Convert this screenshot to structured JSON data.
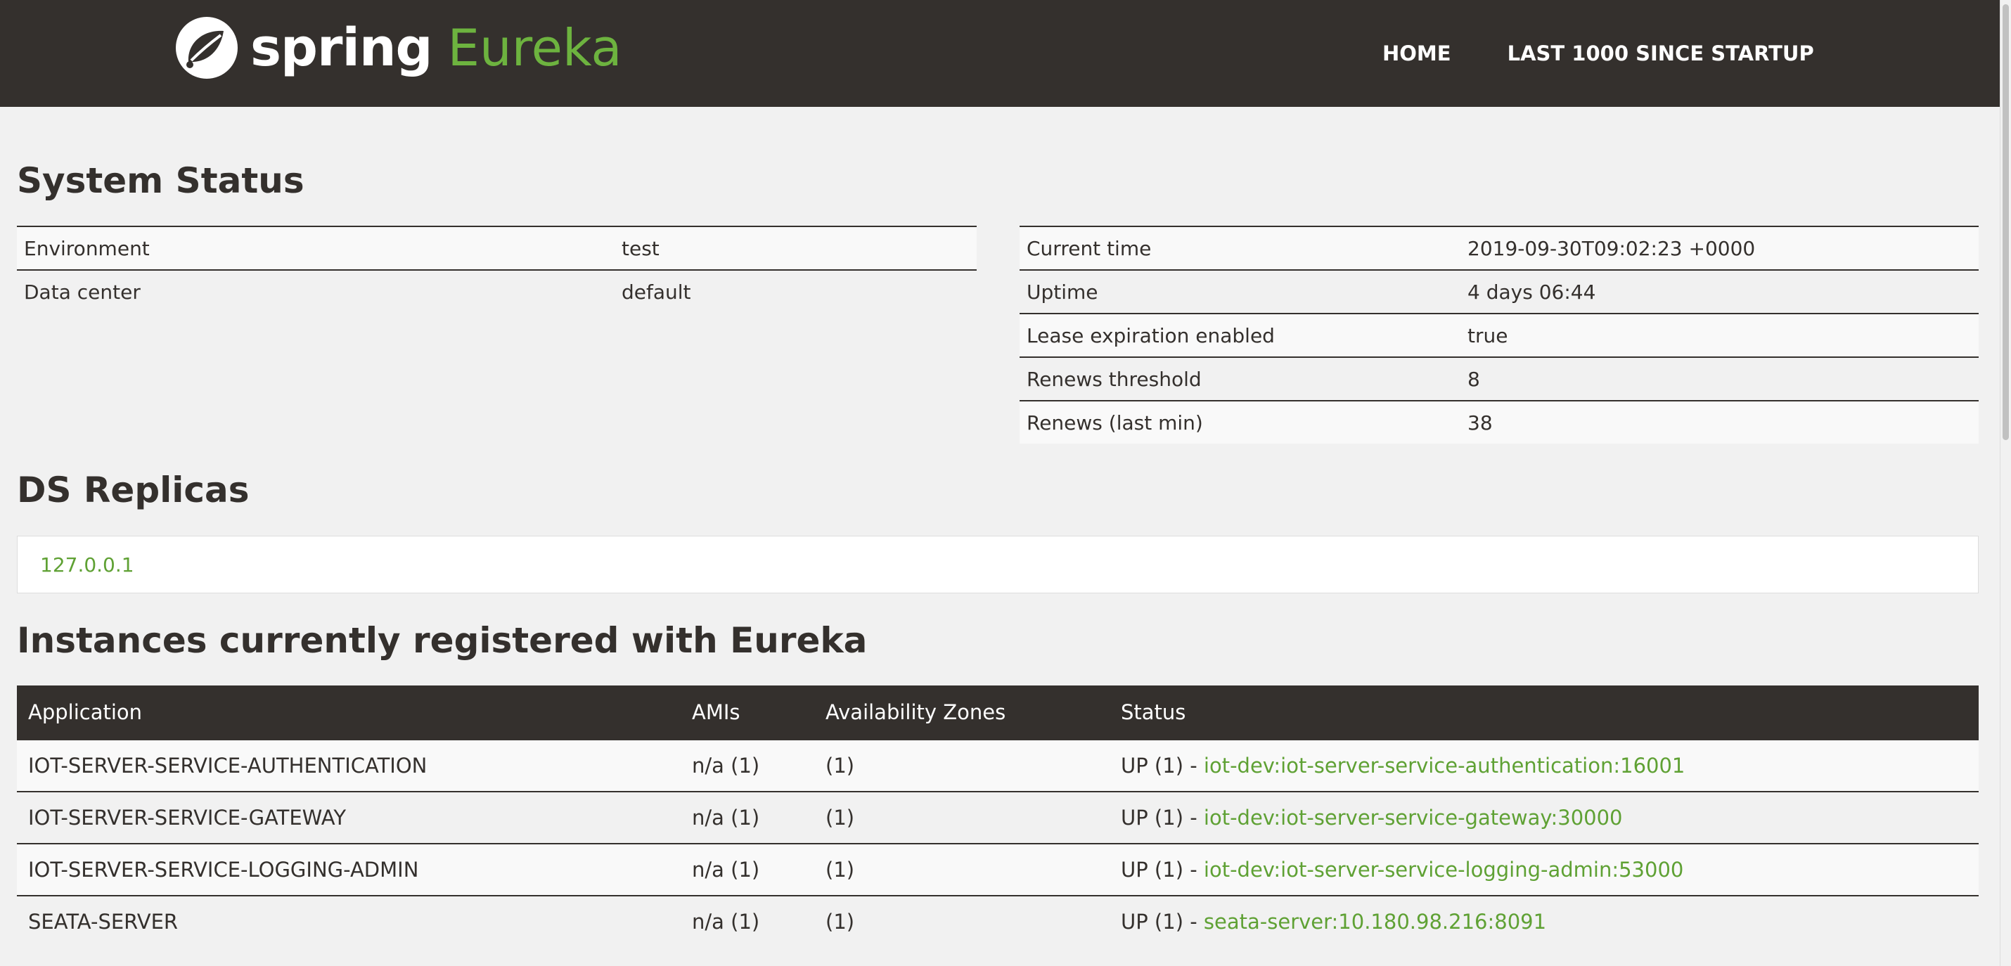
{
  "brand": {
    "spring": "spring",
    "eureka": "Eureka",
    "icon": "spring-leaf-icon"
  },
  "nav": {
    "home": "HOME",
    "last1000": "LAST 1000 SINCE STARTUP"
  },
  "system_status": {
    "title": "System Status",
    "left": [
      {
        "label": "Environment",
        "value": "test"
      },
      {
        "label": "Data center",
        "value": "default"
      }
    ],
    "right": [
      {
        "label": "Current time",
        "value": "2019-09-30T09:02:23 +0000"
      },
      {
        "label": "Uptime",
        "value": "4 days 06:44"
      },
      {
        "label": "Lease expiration enabled",
        "value": "true"
      },
      {
        "label": "Renews threshold",
        "value": "8"
      },
      {
        "label": "Renews (last min)",
        "value": "38"
      }
    ]
  },
  "ds_replicas": {
    "title": "DS Replicas",
    "items": [
      "127.0.0.1"
    ]
  },
  "instances": {
    "title": "Instances currently registered with Eureka",
    "columns": [
      "Application",
      "AMIs",
      "Availability Zones",
      "Status"
    ],
    "rows": [
      {
        "app": "IOT-SERVER-SERVICE-AUTHENTICATION",
        "amis": "n/a (1)",
        "zones": "(1)",
        "status": "UP (1) - ",
        "link": "iot-dev:iot-server-service-authentication:16001"
      },
      {
        "app": "IOT-SERVER-SERVICE-GATEWAY",
        "amis": "n/a (1)",
        "zones": "(1)",
        "status": "UP (1) - ",
        "link": "iot-dev:iot-server-service-gateway:30000"
      },
      {
        "app": "IOT-SERVER-SERVICE-LOGGING-ADMIN",
        "amis": "n/a (1)",
        "zones": "(1)",
        "status": "UP (1) - ",
        "link": "iot-dev:iot-server-service-logging-admin:53000"
      },
      {
        "app": "SEATA-SERVER",
        "amis": "n/a (1)",
        "zones": "(1)",
        "status": "UP (1) - ",
        "link": "seata-server:10.180.98.216:8091"
      }
    ]
  },
  "colors": {
    "header_bg": "#34302d",
    "accent_green": "#6db33f",
    "link_green": "#5fa134",
    "page_bg": "#f1f1f1"
  }
}
